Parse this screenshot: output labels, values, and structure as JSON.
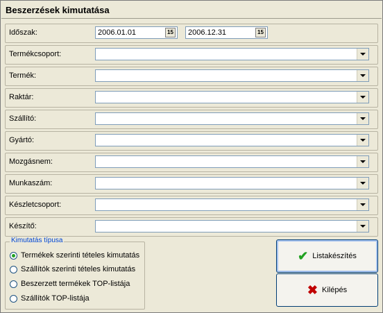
{
  "window": {
    "title": "Beszerzések kimutatása"
  },
  "period": {
    "label": "Időszak:",
    "from": "2006.01.01",
    "to": "2006.12.31",
    "calendar_icon_text": "15"
  },
  "filters": [
    {
      "label": "Termékcsoport:",
      "value": ""
    },
    {
      "label": "Termék:",
      "value": ""
    },
    {
      "label": "Raktár:",
      "value": ""
    },
    {
      "label": "Szállító:",
      "value": ""
    },
    {
      "label": "Gyártó:",
      "value": ""
    },
    {
      "label": "Mozgásnem:",
      "value": ""
    },
    {
      "label": "Munkaszám:",
      "value": ""
    },
    {
      "label": "Készletcsoport:",
      "value": ""
    },
    {
      "label": "Készítő:",
      "value": ""
    }
  ],
  "report_type": {
    "label": "Kimutatás típusa",
    "options": [
      {
        "label": "Termékek szerinti tételes kimutatás",
        "selected": true
      },
      {
        "label": "Szállítók szerinti tételes kimutatás",
        "selected": false
      },
      {
        "label": "Beszerzett termékek TOP-listája",
        "selected": false
      },
      {
        "label": "Szállítók TOP-listája",
        "selected": false
      }
    ]
  },
  "buttons": {
    "list_label": "Listakészítés",
    "list_icon": "checkmark-icon",
    "exit_label": "Kilépés",
    "exit_icon": "x-icon"
  },
  "colors": {
    "accent": "#0046d5",
    "ok_green": "#21a121",
    "cancel_red": "#c00000"
  }
}
